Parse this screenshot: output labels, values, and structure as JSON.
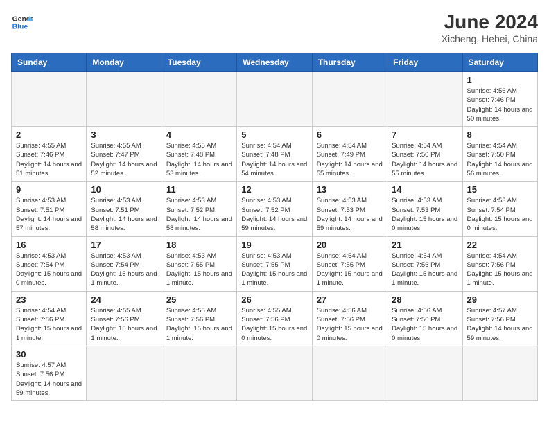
{
  "header": {
    "logo_general": "General",
    "logo_blue": "Blue",
    "month_year": "June 2024",
    "location": "Xicheng, Hebei, China"
  },
  "weekdays": [
    "Sunday",
    "Monday",
    "Tuesday",
    "Wednesday",
    "Thursday",
    "Friday",
    "Saturday"
  ],
  "weeks": [
    [
      {
        "day": "",
        "info": ""
      },
      {
        "day": "",
        "info": ""
      },
      {
        "day": "",
        "info": ""
      },
      {
        "day": "",
        "info": ""
      },
      {
        "day": "",
        "info": ""
      },
      {
        "day": "",
        "info": ""
      },
      {
        "day": "1",
        "info": "Sunrise: 4:56 AM\nSunset: 7:46 PM\nDaylight: 14 hours\nand 50 minutes."
      }
    ],
    [
      {
        "day": "2",
        "info": "Sunrise: 4:55 AM\nSunset: 7:46 PM\nDaylight: 14 hours\nand 51 minutes."
      },
      {
        "day": "3",
        "info": "Sunrise: 4:55 AM\nSunset: 7:47 PM\nDaylight: 14 hours\nand 52 minutes."
      },
      {
        "day": "4",
        "info": "Sunrise: 4:55 AM\nSunset: 7:48 PM\nDaylight: 14 hours\nand 53 minutes."
      },
      {
        "day": "5",
        "info": "Sunrise: 4:54 AM\nSunset: 7:48 PM\nDaylight: 14 hours\nand 54 minutes."
      },
      {
        "day": "6",
        "info": "Sunrise: 4:54 AM\nSunset: 7:49 PM\nDaylight: 14 hours\nand 55 minutes."
      },
      {
        "day": "7",
        "info": "Sunrise: 4:54 AM\nSunset: 7:50 PM\nDaylight: 14 hours\nand 55 minutes."
      },
      {
        "day": "8",
        "info": "Sunrise: 4:54 AM\nSunset: 7:50 PM\nDaylight: 14 hours\nand 56 minutes."
      }
    ],
    [
      {
        "day": "9",
        "info": "Sunrise: 4:53 AM\nSunset: 7:51 PM\nDaylight: 14 hours\nand 57 minutes."
      },
      {
        "day": "10",
        "info": "Sunrise: 4:53 AM\nSunset: 7:51 PM\nDaylight: 14 hours\nand 58 minutes."
      },
      {
        "day": "11",
        "info": "Sunrise: 4:53 AM\nSunset: 7:52 PM\nDaylight: 14 hours\nand 58 minutes."
      },
      {
        "day": "12",
        "info": "Sunrise: 4:53 AM\nSunset: 7:52 PM\nDaylight: 14 hours\nand 59 minutes."
      },
      {
        "day": "13",
        "info": "Sunrise: 4:53 AM\nSunset: 7:53 PM\nDaylight: 14 hours\nand 59 minutes."
      },
      {
        "day": "14",
        "info": "Sunrise: 4:53 AM\nSunset: 7:53 PM\nDaylight: 15 hours\nand 0 minutes."
      },
      {
        "day": "15",
        "info": "Sunrise: 4:53 AM\nSunset: 7:54 PM\nDaylight: 15 hours\nand 0 minutes."
      }
    ],
    [
      {
        "day": "16",
        "info": "Sunrise: 4:53 AM\nSunset: 7:54 PM\nDaylight: 15 hours\nand 0 minutes."
      },
      {
        "day": "17",
        "info": "Sunrise: 4:53 AM\nSunset: 7:54 PM\nDaylight: 15 hours\nand 1 minute."
      },
      {
        "day": "18",
        "info": "Sunrise: 4:53 AM\nSunset: 7:55 PM\nDaylight: 15 hours\nand 1 minute."
      },
      {
        "day": "19",
        "info": "Sunrise: 4:53 AM\nSunset: 7:55 PM\nDaylight: 15 hours\nand 1 minute."
      },
      {
        "day": "20",
        "info": "Sunrise: 4:54 AM\nSunset: 7:55 PM\nDaylight: 15 hours\nand 1 minute."
      },
      {
        "day": "21",
        "info": "Sunrise: 4:54 AM\nSunset: 7:56 PM\nDaylight: 15 hours\nand 1 minute."
      },
      {
        "day": "22",
        "info": "Sunrise: 4:54 AM\nSunset: 7:56 PM\nDaylight: 15 hours\nand 1 minute."
      }
    ],
    [
      {
        "day": "23",
        "info": "Sunrise: 4:54 AM\nSunset: 7:56 PM\nDaylight: 15 hours\nand 1 minute."
      },
      {
        "day": "24",
        "info": "Sunrise: 4:55 AM\nSunset: 7:56 PM\nDaylight: 15 hours\nand 1 minute."
      },
      {
        "day": "25",
        "info": "Sunrise: 4:55 AM\nSunset: 7:56 PM\nDaylight: 15 hours\nand 1 minute."
      },
      {
        "day": "26",
        "info": "Sunrise: 4:55 AM\nSunset: 7:56 PM\nDaylight: 15 hours\nand 0 minutes."
      },
      {
        "day": "27",
        "info": "Sunrise: 4:56 AM\nSunset: 7:56 PM\nDaylight: 15 hours\nand 0 minutes."
      },
      {
        "day": "28",
        "info": "Sunrise: 4:56 AM\nSunset: 7:56 PM\nDaylight: 15 hours\nand 0 minutes."
      },
      {
        "day": "29",
        "info": "Sunrise: 4:57 AM\nSunset: 7:56 PM\nDaylight: 14 hours\nand 59 minutes."
      }
    ],
    [
      {
        "day": "30",
        "info": "Sunrise: 4:57 AM\nSunset: 7:56 PM\nDaylight: 14 hours\nand 59 minutes."
      },
      {
        "day": "",
        "info": ""
      },
      {
        "day": "",
        "info": ""
      },
      {
        "day": "",
        "info": ""
      },
      {
        "day": "",
        "info": ""
      },
      {
        "day": "",
        "info": ""
      },
      {
        "day": "",
        "info": ""
      }
    ]
  ]
}
